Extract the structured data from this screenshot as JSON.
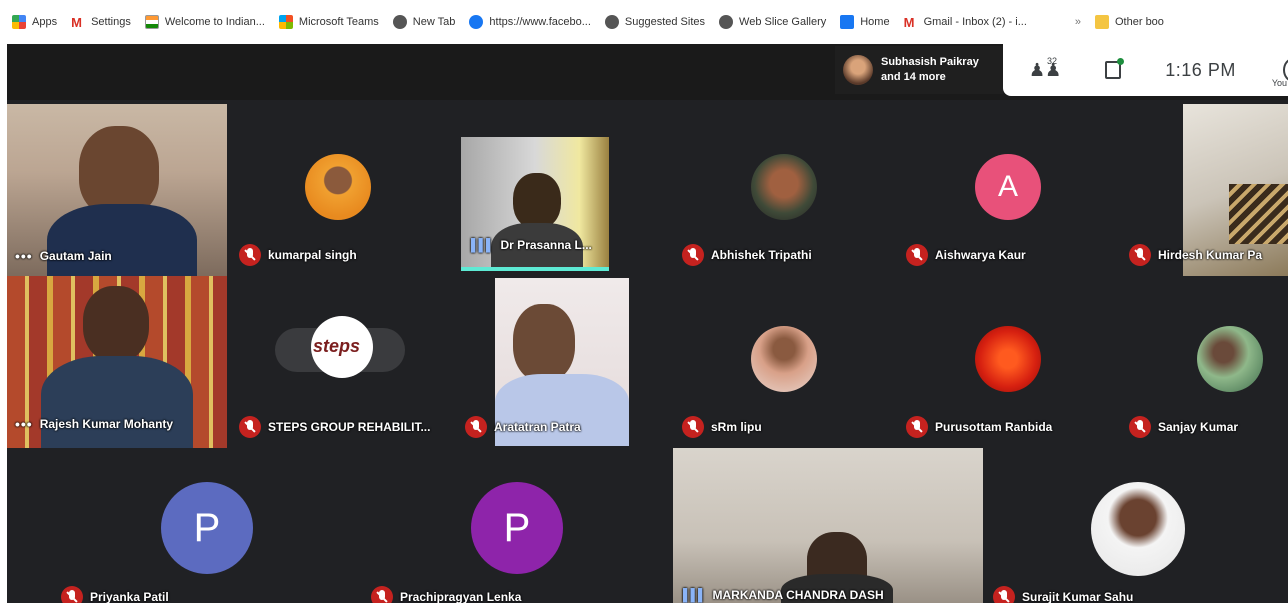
{
  "bookmarks": [
    {
      "label": "Apps",
      "icon": "apps-icon"
    },
    {
      "label": "Settings",
      "icon": "gmail-icon"
    },
    {
      "label": "Welcome to Indian...",
      "icon": "flag-icon"
    },
    {
      "label": "Microsoft Teams",
      "icon": "teams-icon"
    },
    {
      "label": "New Tab",
      "icon": "globe-icon"
    },
    {
      "label": "https://www.facebo...",
      "icon": "facebook-icon"
    },
    {
      "label": "Suggested Sites",
      "icon": "globe-icon"
    },
    {
      "label": "Web Slice Gallery",
      "icon": "globe-icon"
    },
    {
      "label": "Home",
      "icon": "facebook-icon"
    },
    {
      "label": "Gmail - Inbox (2) - i...",
      "icon": "gmail-icon"
    }
  ],
  "bookmarks_more": "»",
  "other_bookmarks": "Other boo",
  "presenter": {
    "name": "Subhasish Paikray",
    "others": "and 14 more"
  },
  "tray": {
    "people_count": "32",
    "time": "1:16 PM",
    "you_label": "You"
  },
  "participants": {
    "gautam": "Gautam Jain",
    "kumarpal": "kumarpal singh",
    "prasanna": "Dr Prasanna L...",
    "abhishek": "Abhishek Tripathi",
    "aishwarya": "Aishwarya Kaur",
    "hirdesh": "Hirdesh Kumar Pa",
    "rajesh": "Rajesh Kumar Mohanty",
    "steps": "STEPS GROUP REHABILIT...",
    "aratatran": "Aratatran Patra",
    "srm": "sRm lipu",
    "purusottam": "Purusottam Ranbida",
    "sanjay": "Sanjay Kumar",
    "priyanka": "Priyanka Patil",
    "prachipragyan": "Prachipragyan Lenka",
    "markanda": "MARKANDA CHANDRA DASH",
    "surajit": "Surajit Kumar Sahu"
  },
  "letters": {
    "aishwarya": "A",
    "priyanka": "P",
    "prachipragyan": "P"
  },
  "steps_logo": "steps",
  "colors": {
    "meet_bg": "#202124",
    "aishwarya_avatar": "#e8517a",
    "priyanka_avatar": "#5c6bc0",
    "prachipragyan_avatar": "#8e24aa",
    "mic_off": "#c5221f"
  }
}
